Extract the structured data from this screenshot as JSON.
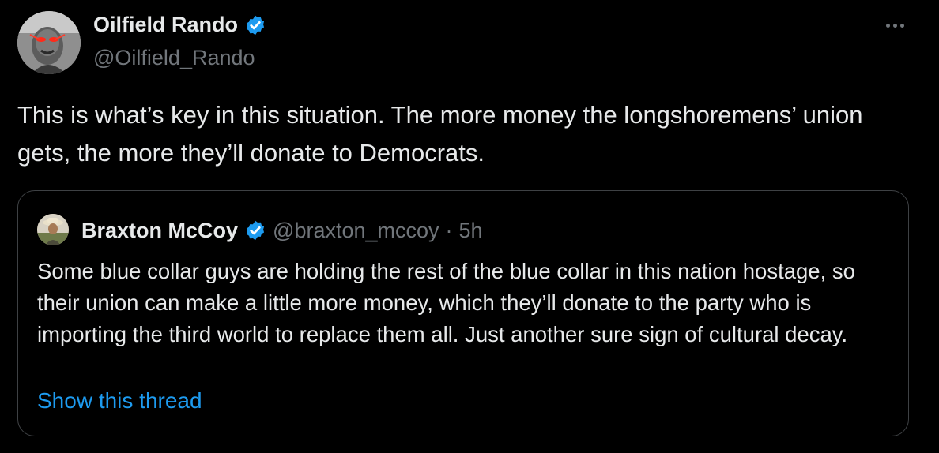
{
  "tweet": {
    "author_name": "Oilfield Rando",
    "author_handle": "@Oilfield_Rando",
    "verified": true,
    "text": "This is what’s key in this situation. The more money the longshoremens’ union gets, the more they’ll donate to Democrats."
  },
  "quoted_tweet": {
    "author_name": "Braxton McCoy",
    "author_handle": "@braxton_mccoy",
    "separator": "·",
    "time": "5h",
    "verified": true,
    "text": "Some blue collar guys are holding the rest of the blue collar in this nation hostage, so their union can make a little more money, which they’ll donate to the party who is importing the third world to replace them all. Just another sure sign of cultural decay.",
    "show_thread_label": "Show this thread"
  },
  "colors": {
    "background": "#000000",
    "primary_text": "#e7e9ea",
    "secondary_text": "#71767b",
    "link": "#1d9bf0",
    "verified_badge": "#1d9bf0",
    "border": "#3e4144"
  },
  "icons": {
    "more": "more-icon",
    "verified": "verified-badge-icon"
  }
}
